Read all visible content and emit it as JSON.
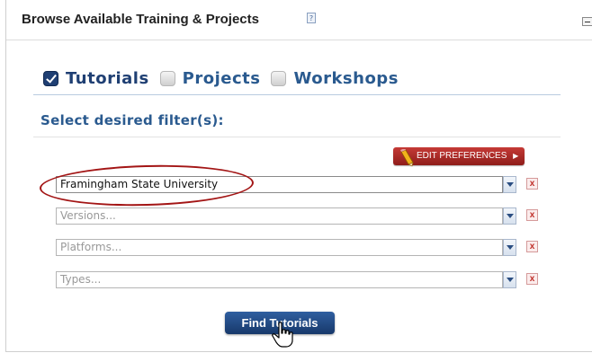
{
  "panel": {
    "title": "Browse Available Training & Projects",
    "help_icon": "help-icon",
    "collapse_icon": "minus-icon"
  },
  "tabs": [
    {
      "label": "Tutorials",
      "checked": true
    },
    {
      "label": "Projects",
      "checked": false
    },
    {
      "label": "Workshops",
      "checked": false
    }
  ],
  "filter_heading": "Select desired filter(s):",
  "edit_preferences": {
    "label": "EDIT PREFERENCES",
    "icon": "pencil-icon",
    "arrow": "▶"
  },
  "filters": [
    {
      "value": "Framingham State University",
      "placeholder": "",
      "clear": "x"
    },
    {
      "value": "",
      "placeholder": "Versions...",
      "clear": "x"
    },
    {
      "value": "",
      "placeholder": "Platforms...",
      "clear": "x"
    },
    {
      "value": "",
      "placeholder": "Types...",
      "clear": "x"
    }
  ],
  "find_button": {
    "label": "Find Tutorials"
  },
  "colors": {
    "brand_blue": "#2a5a8f",
    "button_blue": "#1f3f73",
    "edit_red": "#b02e2a",
    "highlight": "#a31515"
  }
}
